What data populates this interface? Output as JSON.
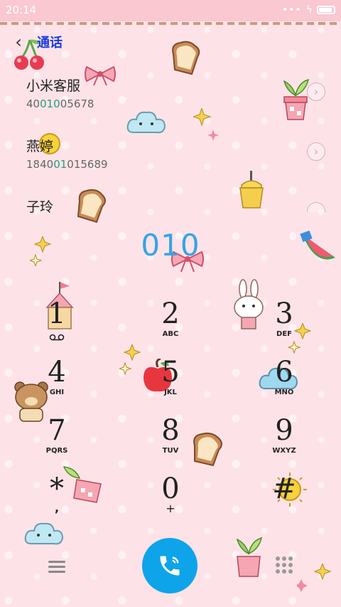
{
  "status_bar": {
    "time": "20:14",
    "icons": [
      "more-dots-icon",
      "charging-bolt-icon",
      "battery-icon"
    ]
  },
  "header": {
    "title": "通话",
    "back_icon": "chevron-left-icon"
  },
  "contacts": [
    {
      "name": "小米客服",
      "number_pre": "40",
      "number_match": "010",
      "number_post": "05678"
    },
    {
      "name": "燕婷",
      "number_pre": "1840",
      "number_match": "01",
      "number_post": "015689"
    },
    {
      "name": "子玲"
    }
  ],
  "dial": {
    "input": "010"
  },
  "keypad": [
    {
      "digit": "1",
      "letters": ""
    },
    {
      "digit": "2",
      "letters": "ABC"
    },
    {
      "digit": "3",
      "letters": "DEF"
    },
    {
      "digit": "4",
      "letters": "GHI"
    },
    {
      "digit": "5",
      "letters": "JKL"
    },
    {
      "digit": "6",
      "letters": "MNO"
    },
    {
      "digit": "7",
      "letters": "PQRS"
    },
    {
      "digit": "8",
      "letters": "TUV"
    },
    {
      "digit": "9",
      "letters": "WXYZ"
    },
    {
      "digit": "*",
      "letters": ","
    },
    {
      "digit": "0",
      "letters": "+"
    },
    {
      "digit": "#",
      "letters": ""
    }
  ],
  "bottom_bar": {
    "icons": [
      "menu-icon",
      "phone-call-icon",
      "keypad-icon"
    ]
  },
  "colors": {
    "background": "#fde3e8",
    "accent": "#34a4e6",
    "call_button": "#0ea4ea",
    "match_highlight": "#2a9b7c",
    "title": "#1a3be0"
  }
}
